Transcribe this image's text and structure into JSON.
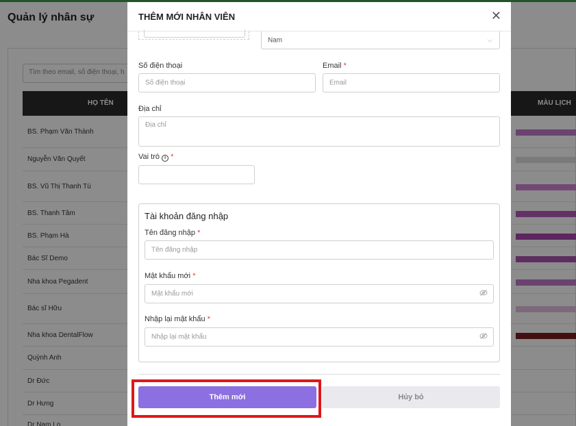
{
  "background": {
    "page_title": "Quản lý nhân sự",
    "search_placeholder": "Tìm theo email, số điện thoại, h",
    "table": {
      "columns": [
        "HỌ TÊN",
        "MÀU LỊCH"
      ],
      "rows": [
        {
          "name": "BS. Phạm Văn Thành",
          "color": "#c47ac9"
        },
        {
          "name": "Nguyễn Văn Quyết",
          "color": "#dedede"
        },
        {
          "name": "BS. Vũ Thị Thanh Tú",
          "color": "#cf85cf"
        },
        {
          "name": "BS. Thanh Tâm",
          "color": "#b25bb8"
        },
        {
          "name": "BS. Phạm Hà",
          "color": "#a845ab"
        },
        {
          "name": "Bác Sĩ Demo",
          "color": "#a855b0"
        },
        {
          "name": "Nha khoa Pegadent",
          "color": "#c37bc9"
        },
        {
          "name": "Bác sĩ Hữu",
          "color": "#e4bfe1"
        },
        {
          "name": "Nha khoa DentalFlow",
          "color": "#7b1e20"
        },
        {
          "name": "Quỳnh Anh",
          "color": ""
        },
        {
          "name": "Dr Đức",
          "color": ""
        },
        {
          "name": "Dr Hưng",
          "color": ""
        },
        {
          "name": "Dr Nam Lo",
          "color": ""
        }
      ]
    }
  },
  "modal": {
    "title": "THÊM MỚI NHÂN VIÊN",
    "gender_value": "Nam",
    "phone": {
      "label": "Số điện thoại",
      "placeholder": "Số điện thoại"
    },
    "email": {
      "label": "Email",
      "required": "*",
      "placeholder": "Email"
    },
    "address": {
      "label": "Địa chỉ",
      "placeholder": "Địa chỉ"
    },
    "role": {
      "label": "Vai trò",
      "required": "*",
      "value": ""
    },
    "account": {
      "title": "Tài khoản đăng nhập",
      "username": {
        "label": "Tên đăng nhập",
        "required": "*",
        "placeholder": "Tên đăng nhập"
      },
      "password": {
        "label": "Mật khẩu mới",
        "required": "*",
        "placeholder": "Mật khẩu mới"
      },
      "confirm": {
        "label": "Nhập lại mật khẩu",
        "required": "*",
        "placeholder": "Nhập lại mật khẩu"
      }
    },
    "submit_label": "Thêm mới",
    "cancel_label": "Hủy bỏ"
  },
  "colors": {
    "accent": "#8c6fe0",
    "highlight": "#e0161b",
    "required": "#e53935"
  }
}
